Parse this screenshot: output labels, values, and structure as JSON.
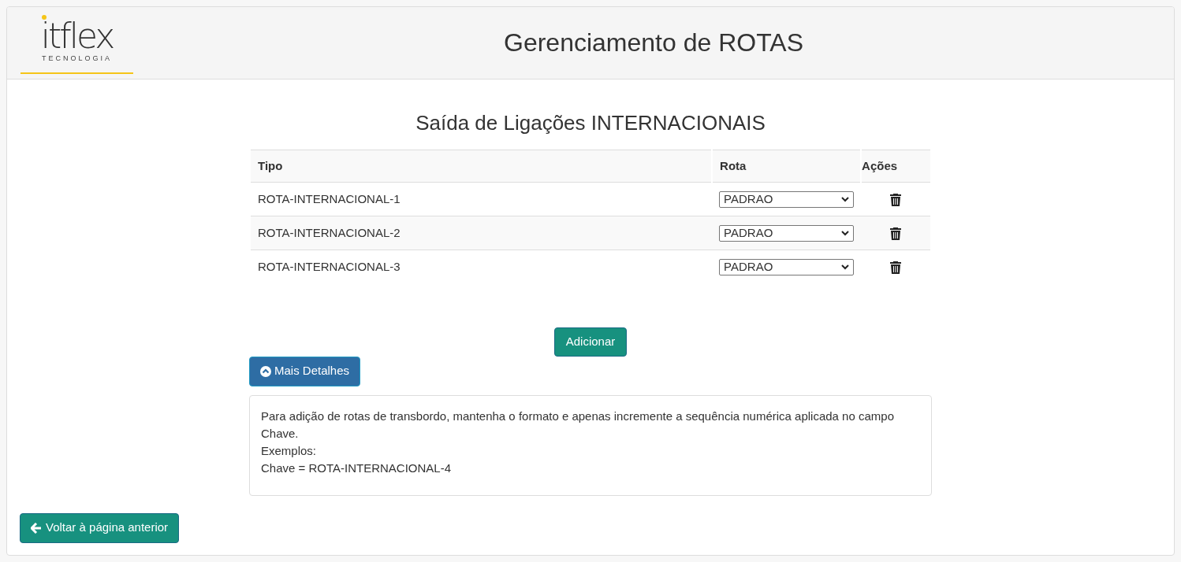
{
  "header": {
    "logo": {
      "wordmark": "itflex",
      "tagline": "TECNOLOGIA"
    },
    "title": "Gerenciamento de ROTAS"
  },
  "section_title": "Saída de Ligações INTERNACIONAIS",
  "table": {
    "columns": [
      "Tipo",
      "Rota",
      "Ações"
    ],
    "rows": [
      {
        "tipo": "ROTA-INTERNACIONAL-1",
        "rota": "PADRAO"
      },
      {
        "tipo": "ROTA-INTERNACIONAL-2",
        "rota": "PADRAO"
      },
      {
        "tipo": "ROTA-INTERNACIONAL-3",
        "rota": "PADRAO"
      }
    ]
  },
  "add_button": "Adicionar",
  "details_button": {
    "label": "Mais Detalhes",
    "expanded": true
  },
  "details_text": [
    "Para adição de rotas de transbordo, mantenha o formato e apenas incremente a sequência numérica aplicada no campo Chave.",
    "Exemplos:",
    "Chave = ROTA-INTERNACIONAL-4"
  ],
  "back_button": "Voltar à página anterior"
}
